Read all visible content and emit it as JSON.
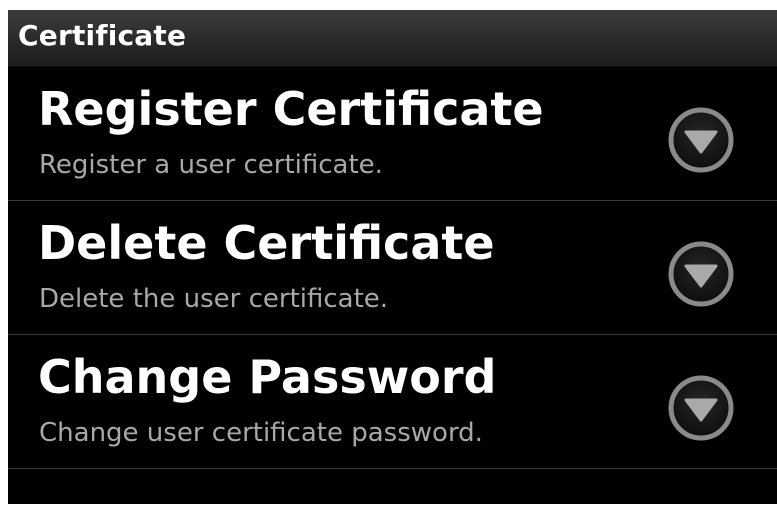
{
  "header": {
    "title": "Certificate"
  },
  "items": [
    {
      "title": "Register Certificate",
      "summary": "Register a user certificate.",
      "icon": "chevron-down-circle-icon"
    },
    {
      "title": "Delete Certificate",
      "summary": "Delete the user certificate.",
      "icon": "chevron-down-circle-icon"
    },
    {
      "title": "Change Password",
      "summary": "Change user certificate password.",
      "icon": "chevron-down-circle-icon"
    }
  ],
  "colors": {
    "background": "#000000",
    "title_text": "#ffffff",
    "summary_text": "#a8a8a8",
    "divider": "#3a3a3a",
    "icon_ring": "#8a8a8a"
  }
}
